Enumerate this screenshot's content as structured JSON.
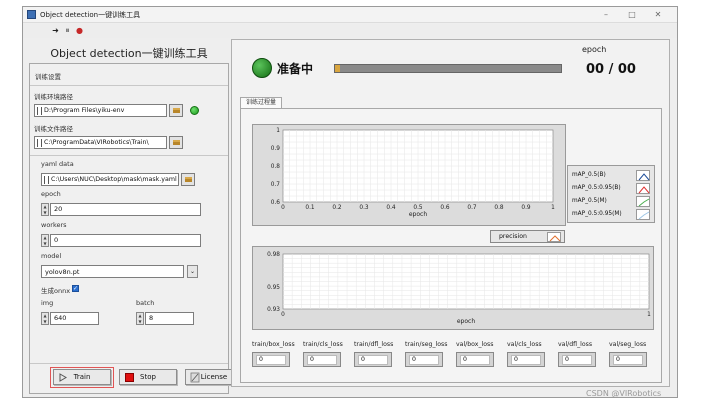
{
  "window": {
    "title": "Object detection一键训练工具",
    "controls": {
      "minimize": "–",
      "maximize": "□",
      "close": "✕"
    }
  },
  "toolbar": {
    "run": "➜",
    "pause": "⏸",
    "stop": "●"
  },
  "app_title": "Object detection一键训练工具",
  "settings": {
    "section": "训练设置",
    "env_path_label": "训练环境路径",
    "env_path": "D:\\Program Files\\yiku-env",
    "train_path_label": "训练文件路径",
    "train_path": "C:\\ProgramData\\VIRobotics\\Train\\",
    "yaml_label": "yaml data",
    "yaml_path": "C:\\Users\\NUC\\Desktop\\mask\\mask.yaml",
    "epoch_label": "epoch",
    "epoch_value": "20",
    "workers_label": "workers",
    "workers_value": "0",
    "model_label": "model",
    "model_value": "yolov8n.pt",
    "onnx_label": "生成onnx",
    "onnx_checked": true,
    "img_label": "img",
    "img_value": "640",
    "batch_label": "batch",
    "batch_value": "8"
  },
  "buttons": {
    "train": "Train",
    "stop": "Stop",
    "license": "License"
  },
  "status": {
    "text": "准备中",
    "progress": 0,
    "epoch_label": "epoch",
    "epoch_value": "00 / 00"
  },
  "tab": {
    "label": "训练过程量"
  },
  "chart_data": [
    {
      "type": "line",
      "xlabel": "epoch",
      "ylabel": "",
      "xlim": [
        0,
        1
      ],
      "ylim": [
        0.6,
        1
      ],
      "xticks": [
        "0",
        "0.1",
        "0.2",
        "0.3",
        "0.4",
        "0.5",
        "0.6",
        "0.7",
        "0.8",
        "0.9",
        "1"
      ],
      "yticks": [
        "1",
        "0.9",
        "0.8",
        "0.7",
        "0.6"
      ],
      "series": [
        {
          "name": "mAP_0.5(B)",
          "color": "#1e4e9a",
          "values": []
        },
        {
          "name": "mAP_0.5:0.95(B)",
          "color": "#e03030",
          "values": []
        },
        {
          "name": "mAP_0.5(M)",
          "color": "#4caf50",
          "values": []
        },
        {
          "name": "mAP_0.5:0.95(M)",
          "color": "#9ec6e6",
          "values": []
        }
      ],
      "grid": true
    },
    {
      "type": "line",
      "xlabel": "epoch",
      "ylabel": "",
      "xlim": [
        0,
        1
      ],
      "ylim": [
        0.93,
        0.98
      ],
      "xticks": [
        "0",
        "1"
      ],
      "yticks": [
        "0.98",
        "0.95",
        "0.93"
      ],
      "series": [
        {
          "name": "precision",
          "color": "#e07030",
          "values": []
        }
      ],
      "grid": true
    }
  ],
  "losses": [
    {
      "label": "train/box_loss",
      "value": "0"
    },
    {
      "label": "train/cls_loss",
      "value": "0"
    },
    {
      "label": "train/dfl_loss",
      "value": "0"
    },
    {
      "label": "train/seg_loss",
      "value": "0"
    },
    {
      "label": "val/box_loss",
      "value": "0"
    },
    {
      "label": "val/cls_loss",
      "value": "0"
    },
    {
      "label": "val/dfl_loss",
      "value": "0"
    },
    {
      "label": "val/seg_loss",
      "value": "0"
    }
  ],
  "watermark": "CSDN @VIRobotics"
}
